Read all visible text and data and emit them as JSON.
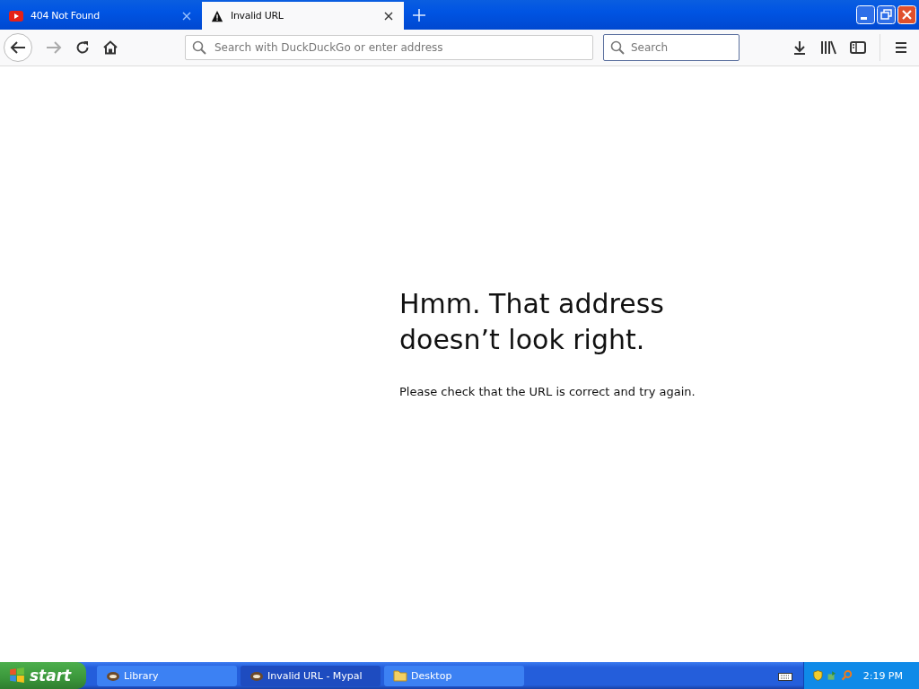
{
  "tabs": [
    {
      "label": "404 Not Found",
      "selected": false,
      "kind": "video"
    },
    {
      "label": "Invalid URL",
      "selected": true,
      "kind": "warning"
    }
  ],
  "address_bar": {
    "placeholder": "Search with DuckDuckGo or enter address"
  },
  "search": {
    "placeholder": "Search",
    "focused": true
  },
  "error": {
    "title": "Hmm. That address doesn’t look right.",
    "message": "Please check that the URL is correct and try again."
  },
  "taskbar": {
    "start": "start",
    "tasks": [
      {
        "label": "Library",
        "selected": false,
        "kind": "app"
      },
      {
        "label": "Invalid URL - Mypal",
        "selected": true,
        "kind": "app"
      },
      {
        "label": "Desktop",
        "selected": false,
        "kind": "folder"
      }
    ],
    "clock": "2:19 PM"
  }
}
